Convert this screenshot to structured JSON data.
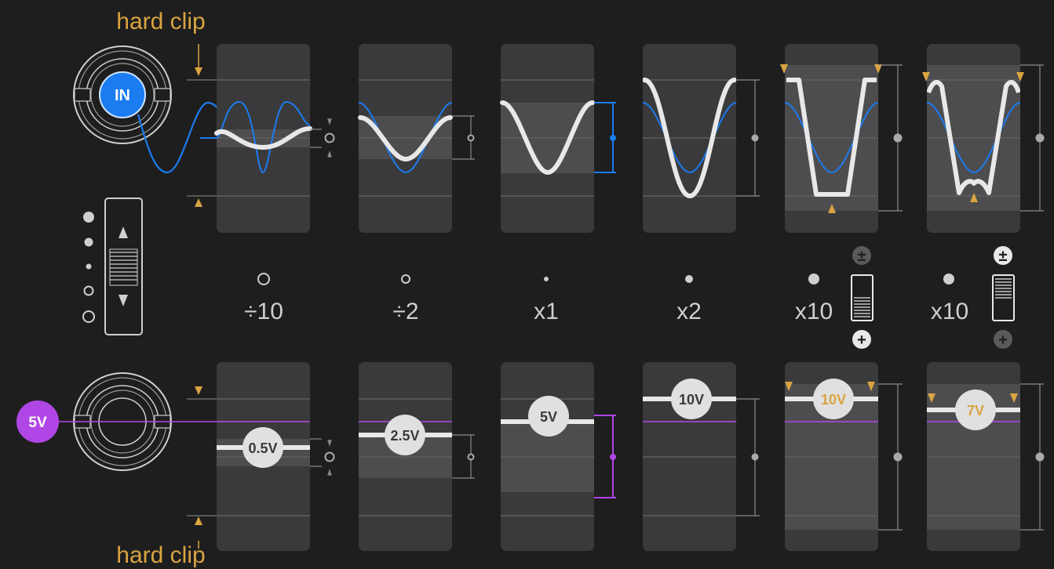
{
  "annotations": {
    "hard_clip_top": "hard clip",
    "hard_clip_bottom": "hard clip"
  },
  "input_jack": {
    "label": "IN"
  },
  "offset_jack": {
    "label": "5V"
  },
  "settings": [
    {
      "label": "÷10",
      "cv": "0.5V"
    },
    {
      "label": "÷2",
      "cv": "2.5V"
    },
    {
      "label": "x1",
      "cv": "5V"
    },
    {
      "label": "x2",
      "cv": "10V"
    },
    {
      "label": "x10",
      "cv": "10V"
    },
    {
      "label": "x10",
      "cv": "7V"
    }
  ],
  "switch_symbols": {
    "bipolar": "±",
    "unipolar": "+"
  },
  "colors": {
    "background": "#1e1e1f",
    "panel": "#3a3a3c",
    "input_blue": "#1a7cf0",
    "offset_purple": "#b146e6",
    "clip_gold": "#d9a441",
    "wave_white": "#e8e8e8"
  }
}
